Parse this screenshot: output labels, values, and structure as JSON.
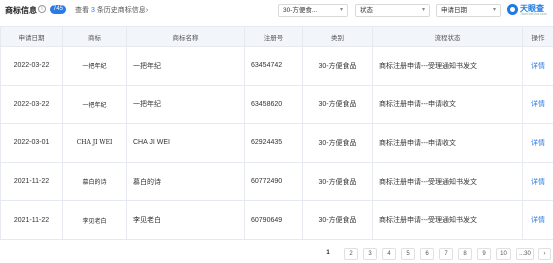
{
  "header": {
    "title": "商标信息",
    "info_icon": "info-icon",
    "count": "745",
    "history_prefix": "查看",
    "history_num": "3",
    "history_suffix": "条历史商标信息",
    "history_chevron": "›"
  },
  "filters": {
    "classification": "30-方便食...",
    "status": "状态",
    "apply_date": "申请日期"
  },
  "logo": {
    "name": "天眼查",
    "sub": "TianYanCha.com"
  },
  "table": {
    "headers": [
      "申请日期",
      "商标",
      "商标名称",
      "注册号",
      "类别",
      "流程状态",
      "操作"
    ],
    "rows": [
      {
        "date": "2022-03-22",
        "image_text": "一把年纪",
        "name": "一把年纪",
        "reg_no": "63454742",
        "class": "30-方便食品",
        "status": "商标注册申请---受理通知书发文",
        "action": "详情"
      },
      {
        "date": "2022-03-22",
        "image_text": "一把年纪",
        "name": "一把年纪",
        "reg_no": "63458620",
        "class": "30-方便食品",
        "status": "商标注册申请---申请收文",
        "action": "详情"
      },
      {
        "date": "2022-03-01",
        "image_text": "CHA JI WEI",
        "name": "CHA JI WEI",
        "reg_no": "62924435",
        "class": "30-方便食品",
        "status": "商标注册申请---申请收文",
        "action": "详情"
      },
      {
        "date": "2021-11-22",
        "image_text": "慕白的诗",
        "name": "慕白的诗",
        "reg_no": "60772490",
        "class": "30-方便食品",
        "status": "商标注册申请---受理通知书发文",
        "action": "详情"
      },
      {
        "date": "2021-11-22",
        "image_text": "李见老白",
        "name": "李见老白",
        "reg_no": "60790649",
        "class": "30-方便食品",
        "status": "商标注册申请---受理通知书发文",
        "action": "详情"
      }
    ]
  },
  "pagination": {
    "pages": [
      "1",
      "2",
      "3",
      "4",
      "5",
      "6",
      "7",
      "8",
      "9",
      "10",
      "...30",
      "›"
    ],
    "active": "1"
  },
  "colors": {
    "accent": "#2c7be5",
    "header_bg": "#f2f5fa",
    "border": "#e6e9ef"
  }
}
